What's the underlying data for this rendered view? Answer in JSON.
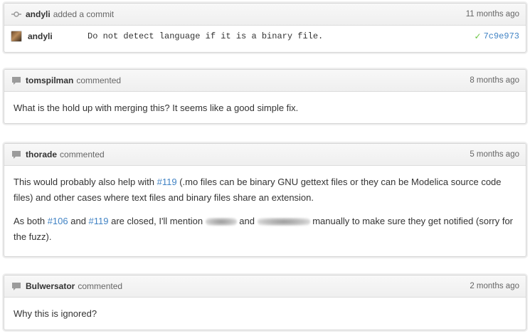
{
  "timeline": {
    "commit_event": {
      "author": "andyli",
      "action": "added a commit",
      "time": "11 months ago",
      "icon": "commit-icon",
      "commit": {
        "author": "andyli",
        "message": "Do not detect language if it is a binary file.",
        "sha": "7c9e973",
        "status_icon": "check-icon",
        "status_color": "#6cc644"
      }
    },
    "comments": [
      {
        "author": "tomspilman",
        "action": "commented",
        "time": "8 months ago",
        "text": "What is the hold up with merging this? It seems like a good simple fix."
      },
      {
        "author": "thorade",
        "action": "commented",
        "time": "5 months ago",
        "p1_before": "This would probably also help with ",
        "p1_ref": "#119",
        "p1_after": " (.mo files can be binary GNU gettext files or they can be Modelica source code files) and other cases where text files and binary files share an extension.",
        "p2_a": "As both ",
        "p2_ref1": "#106",
        "p2_b": " and ",
        "p2_ref2": "#119",
        "p2_c": " are closed, I'll mention ",
        "p2_d": " and ",
        "p2_e": " manually to make sure they get notified (sorry for the fuzz)."
      },
      {
        "author": "Bulwersator",
        "action": "commented",
        "time": "2 months ago",
        "text": "Why this is ignored?"
      }
    ],
    "colors": {
      "link": "#4183c4",
      "header_bg": "#f3f3f3",
      "border": "#d5d5d5"
    }
  }
}
